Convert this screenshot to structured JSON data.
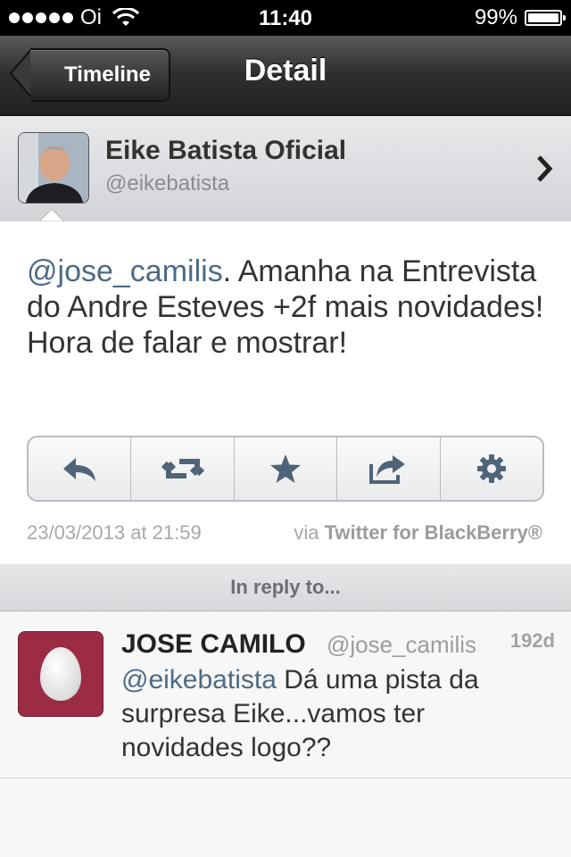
{
  "status_bar": {
    "carrier": "Oi",
    "time": "11:40",
    "battery": "99%",
    "battery_level": 0.99
  },
  "nav": {
    "back_label": "Timeline",
    "title": "Detail"
  },
  "profile": {
    "name": "Eike Batista Oficial",
    "handle": "@eikebatista"
  },
  "tweet": {
    "mention": "@jose_camilis",
    "text": ". Amanha na Entrevista do Andre Esteves +2f mais novidades! Hora de falar e mostrar!",
    "date": "23/03/2013 at 21:59",
    "via_prefix": "via ",
    "via_app": "Twitter for BlackBerry®",
    "actions": [
      "reply-icon",
      "retweet-icon",
      "star-icon",
      "share-icon",
      "gear-icon"
    ]
  },
  "reply_section": {
    "header": "In reply to..."
  },
  "reply": {
    "name": "JOSE CAMILO",
    "handle": "@jose_camilis",
    "time": "192d",
    "mention": "@eikebatista",
    "text": " Dá uma pista da surpresa Eike...vamos ter novidades logo??"
  },
  "colors": {
    "link": "#4d6a85",
    "reply_avatar_bg": "#9b2c44",
    "navbar": "#2e2e2e"
  }
}
